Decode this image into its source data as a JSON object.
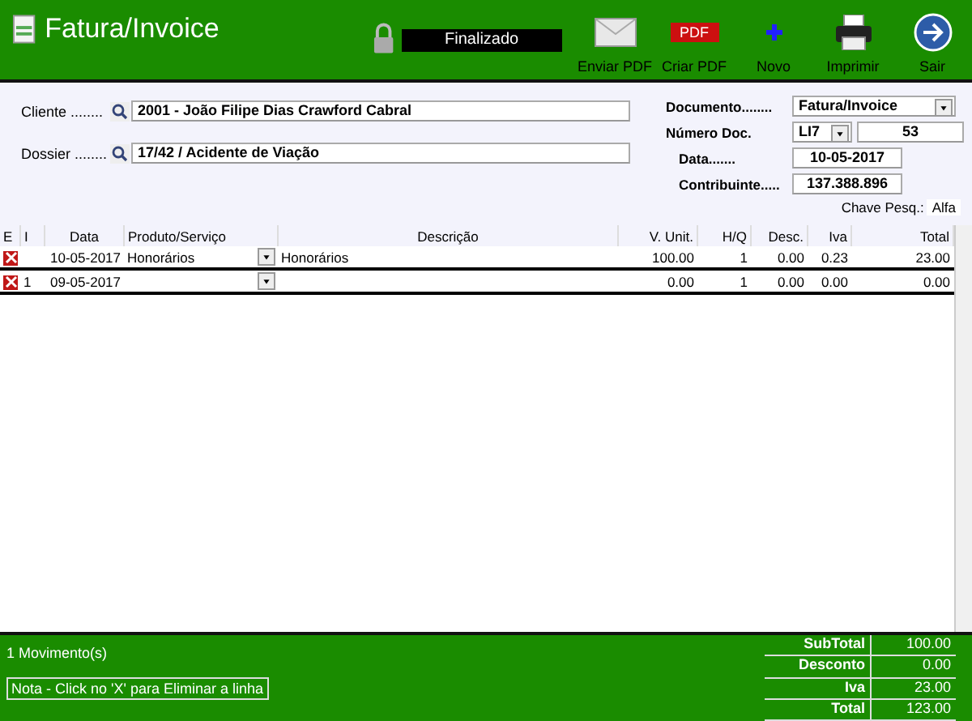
{
  "window": {
    "title": "Fatura/Invoice"
  },
  "status": "Finalizado",
  "toolbar": [
    {
      "kind": "mail",
      "label": "Enviar PDF"
    },
    {
      "kind": "pdf",
      "label": "Criar PDF",
      "badge": "PDF"
    },
    {
      "kind": "plus",
      "label": "Novo"
    },
    {
      "kind": "printer",
      "label": "Imprimir"
    },
    {
      "kind": "exit",
      "label": "Sair"
    }
  ],
  "form": {
    "cliente_label": "Cliente ........",
    "cliente": "2001 - João Filipe Dias Crawford Cabral",
    "dossier_label": "Dossier ........",
    "dossier": "17/42 / Acidente de Viação",
    "documento_label": "Documento........",
    "documento": "Fatura/Invoice",
    "numero_label": "Número Doc.",
    "serie": "LI7",
    "numero": "53",
    "data_label": "Data.......",
    "data": "10-05-2017",
    "contribuinte_label": "Contribuinte.....",
    "contribuinte": "137.388.896"
  },
  "search": {
    "label": "Chave Pesq.:",
    "value": "Alfa"
  },
  "table": {
    "columns": [
      "E",
      "I",
      "Data",
      "Produto/Serviço",
      "Descrição",
      "V. Unit.",
      "H/Q",
      "Desc.",
      "Iva",
      "Total"
    ],
    "rows": [
      {
        "id": "",
        "data": "10-05-2017",
        "produto": "Honorários",
        "descricao": "Honorários",
        "unit": "100.00",
        "qtd": "1",
        "desc": "0.00",
        "iva": "0.23",
        "total": "23.00",
        "selected": false
      },
      {
        "id": "1",
        "data": "09-05-2017",
        "produto": "",
        "descricao": "",
        "unit": "0.00",
        "qtd": "1",
        "desc": "0.00",
        "iva": "0.00",
        "total": "0.00",
        "selected": true
      }
    ]
  },
  "footer": {
    "count": "1 Movimento(s)",
    "note": "Nota - Click no 'X' para Eliminar a linha",
    "totals": [
      {
        "label": "SubTotal",
        "value": "100.00"
      },
      {
        "label": "Desconto",
        "value": "0.00"
      },
      {
        "label": "Iva",
        "value": "23.00"
      },
      {
        "label": "Total",
        "value": "123.00"
      }
    ]
  }
}
